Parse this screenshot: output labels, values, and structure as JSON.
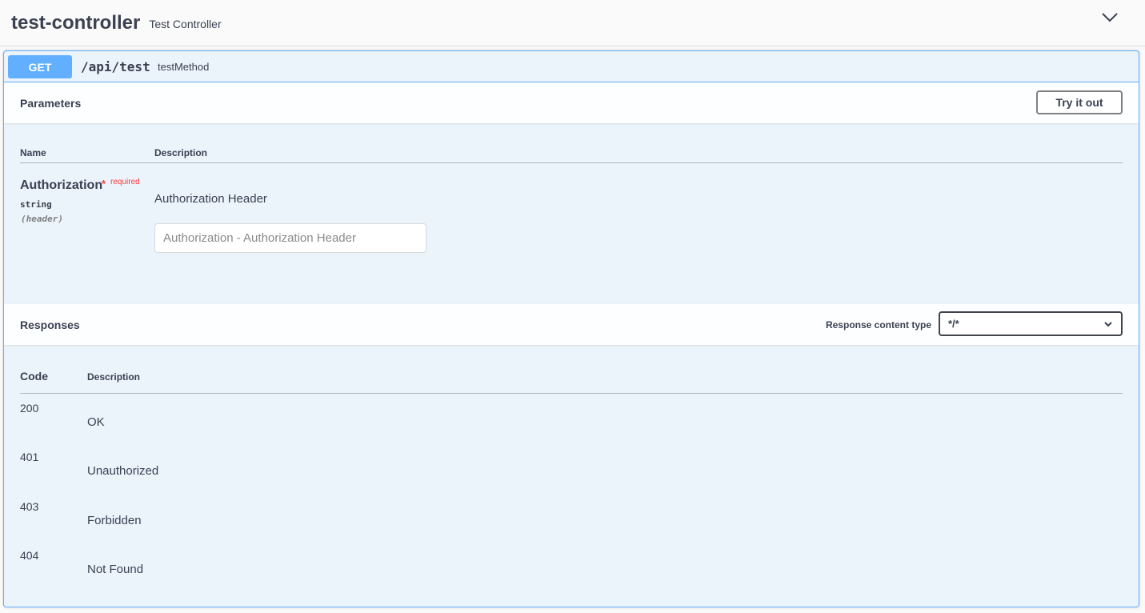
{
  "tag": {
    "name": "test-controller",
    "description": "Test Controller"
  },
  "operation": {
    "method": "GET",
    "path": "/api/test",
    "summary": "testMethod",
    "method_color": "#61affe"
  },
  "parameters": {
    "title": "Parameters",
    "try_button": "Try it out",
    "headers": {
      "name": "Name",
      "description": "Description"
    },
    "items": [
      {
        "name": "Authorization",
        "required_star": "*",
        "required_label": "required",
        "type": "string",
        "in": "(header)",
        "description": "Authorization Header",
        "placeholder": "Authorization - Authorization Header",
        "value": ""
      }
    ]
  },
  "responses": {
    "title": "Responses",
    "content_type_label": "Response content type",
    "content_type_value": "*/*",
    "headers": {
      "code": "Code",
      "description": "Description"
    },
    "rows": [
      {
        "code": "200",
        "description": "OK"
      },
      {
        "code": "401",
        "description": "Unauthorized"
      },
      {
        "code": "403",
        "description": "Forbidden"
      },
      {
        "code": "404",
        "description": "Not Found"
      }
    ]
  }
}
